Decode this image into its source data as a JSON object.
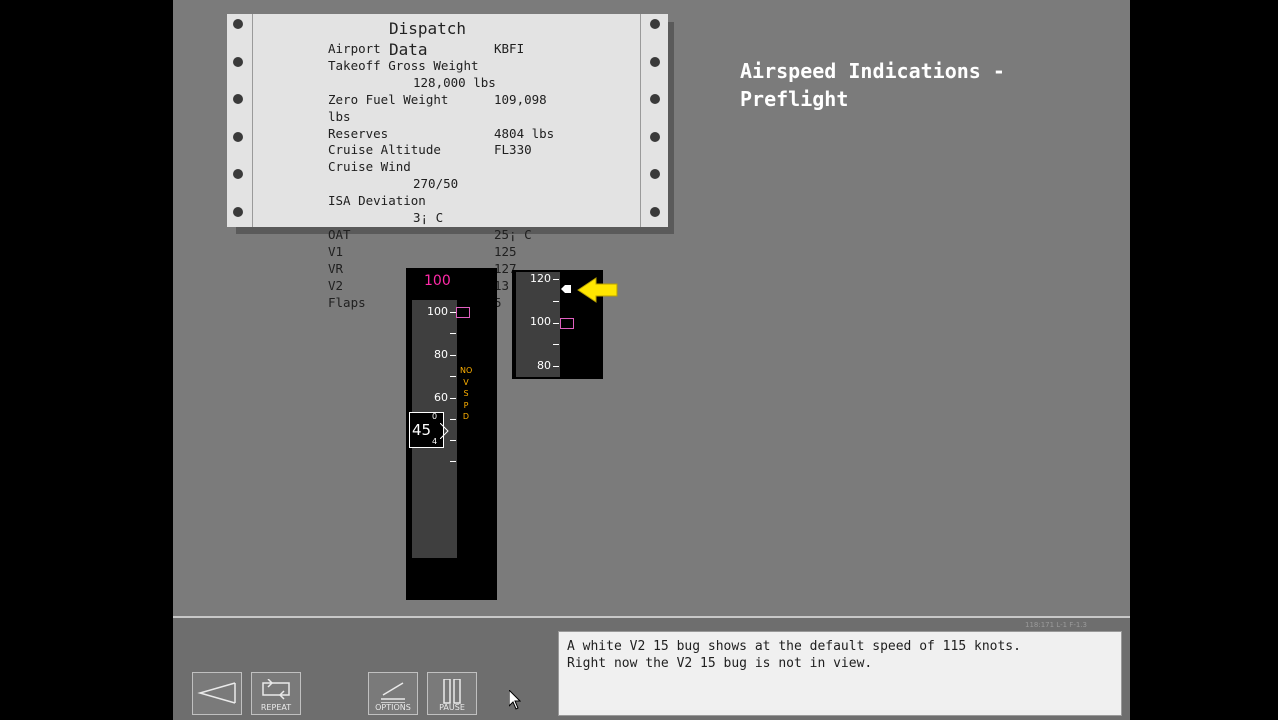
{
  "slide": {
    "title_line1": "Airspeed Indications -",
    "title_line2": "Preflight"
  },
  "dispatch": {
    "title": "Dispatch",
    "subtitle": "Data",
    "rows": [
      {
        "label": "Airport",
        "value": "KBFI"
      },
      {
        "label": "Takeoff Gross Weight",
        "value": ""
      },
      {
        "label": "",
        "value": "128,000 lbs"
      },
      {
        "label": "Zero Fuel Weight",
        "value": "109,098"
      },
      {
        "label": "lbs",
        "value": ""
      },
      {
        "label": "Reserves",
        "value": "4804 lbs"
      },
      {
        "label": "Cruise Altitude",
        "value": "FL330"
      },
      {
        "label": "Cruise Wind",
        "value": ""
      },
      {
        "label": "",
        "value": "270/50"
      },
      {
        "label": "ISA Deviation",
        "value": ""
      },
      {
        "label": "",
        "value": "3¡ C"
      },
      {
        "label": "OAT",
        "value": "25¡ C"
      },
      {
        "label": "V1",
        "value": "125"
      },
      {
        "label": "VR",
        "value": "127"
      },
      {
        "label": "V2",
        "value": "13"
      },
      {
        "label": "Flaps",
        "value": "5"
      }
    ]
  },
  "tape1": {
    "selected_speed": "100",
    "ticks": [
      "100",
      "80",
      "60"
    ],
    "no_vspd": [
      "NO",
      "V",
      "S",
      "P",
      "D"
    ],
    "current_speed": "45",
    "readout_small_top": "0",
    "readout_small_bottom": "4"
  },
  "tape2": {
    "ticks": [
      "120",
      "100",
      "80"
    ]
  },
  "controls": {
    "back_label": "",
    "repeat_label": "REPEAT",
    "options_label": "OPTIONS",
    "pause_label": "PAUSE"
  },
  "message": {
    "line1": "A white V2 15 bug shows at the default speed of 115 knots.",
    "line2": "Right now the V2 15 bug is not in view."
  },
  "page_id": "118:171   L-1 F-1.3",
  "colors": {
    "stage": "#7b7b7b",
    "bug": "#e060c0",
    "accent_magenta": "#ff2aa8",
    "arrow": "#ffe600",
    "novspd": "#ffb000"
  }
}
